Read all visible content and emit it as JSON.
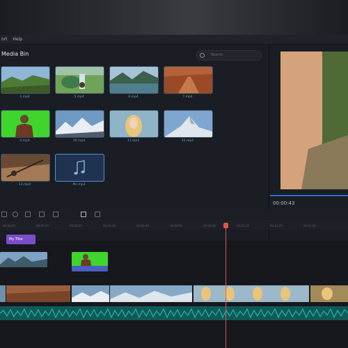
{
  "menubar": {
    "items": [
      "ort",
      "Help"
    ]
  },
  "media_bin": {
    "title": "Media Bin",
    "search_placeholder": "Search",
    "items": [
      {
        "caption": "4.mp4",
        "icon": "valley-landscape-thumbnail"
      },
      {
        "caption": "5.mp4",
        "icon": "hiker-waterfall-thumbnail"
      },
      {
        "caption": "6.mp4",
        "icon": "mountain-lake-thumbnail"
      },
      {
        "caption": "7.mp4",
        "icon": "desert-road-thumbnail"
      },
      {
        "caption": "9.mp4",
        "icon": "greenscreen-person-thumbnail"
      },
      {
        "caption": "10.mp4",
        "icon": "snowy-mountains-thumbnail"
      },
      {
        "caption": "11.mp4",
        "icon": "blonde-woman-thumbnail"
      },
      {
        "caption": "12.mp4",
        "icon": "mountain-peak-thumbnail"
      },
      {
        "caption": "13.mp4",
        "icon": "hiker-selfie-thumbnail"
      },
      {
        "caption": "Mc.mp3",
        "icon": "music-note-icon"
      }
    ]
  },
  "preview": {
    "timecode": "00:00:43"
  },
  "timeline": {
    "ruler_ticks": [
      "00:00:00",
      "00:00:10",
      "00:00:20",
      "00:00:30",
      "00:00:40",
      "00:00:50",
      "00:01:00",
      "00:01:10",
      "00:01:20",
      "00:01:30"
    ],
    "title_clip_label": "My Title"
  },
  "colors": {
    "accent": "#2b6fcf",
    "playhead": "#e0554b",
    "title_clip": "#7b4dc8",
    "audio_track": "#1d8f86"
  }
}
